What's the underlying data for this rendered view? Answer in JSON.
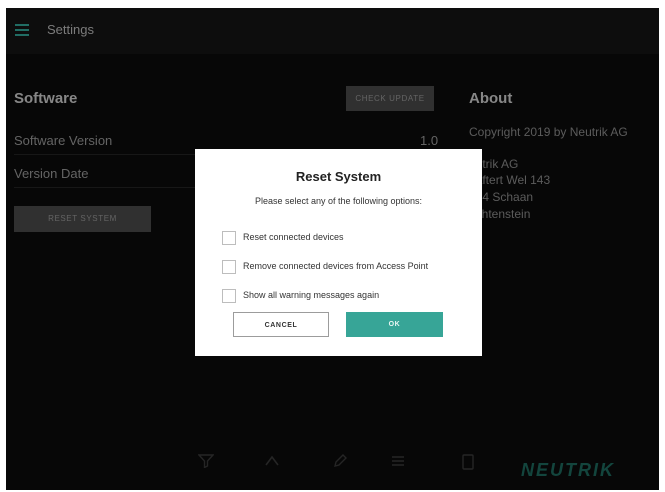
{
  "header": {
    "title": "Settings",
    "right_text": ""
  },
  "software": {
    "title": "Software",
    "update_button": "CHECK UPDATE",
    "rows": [
      {
        "label": "Software Version",
        "value": "1.0"
      },
      {
        "label": "Version Date",
        "value": ""
      }
    ],
    "reset_button": "RESET SYSTEM"
  },
  "about": {
    "title": "About",
    "lines": [
      "Copyright 2019 by Neutrik AG",
      "eutrik AG",
      "Laftert Wel 143",
      "494 Schaan",
      "echtenstein"
    ]
  },
  "dialog": {
    "title": "Reset System",
    "subtitle": "Please select any of the following options:",
    "options": [
      {
        "label": "Reset connected devices",
        "checked": false
      },
      {
        "label": "Remove connected devices from Access Point",
        "checked": false
      },
      {
        "label": "Show all warning messages again",
        "checked": false
      }
    ],
    "cancel_label": "CANCEL",
    "ok_label": "OK"
  },
  "nav": {
    "items": [
      {
        "icon": "funnel-icon",
        "label": ""
      },
      {
        "icon": "chevron-up-icon",
        "label": ""
      },
      {
        "icon": "pencil-icon",
        "label": ""
      },
      {
        "icon": "list-icon",
        "label": ""
      },
      {
        "icon": "tablet-icon",
        "label": ""
      }
    ]
  },
  "brand": "NEUTRIK",
  "colors": {
    "accent": "#37a597",
    "background": "#0b0b0b",
    "dialog": "#ffffff",
    "brand": "#1e6a5f"
  }
}
